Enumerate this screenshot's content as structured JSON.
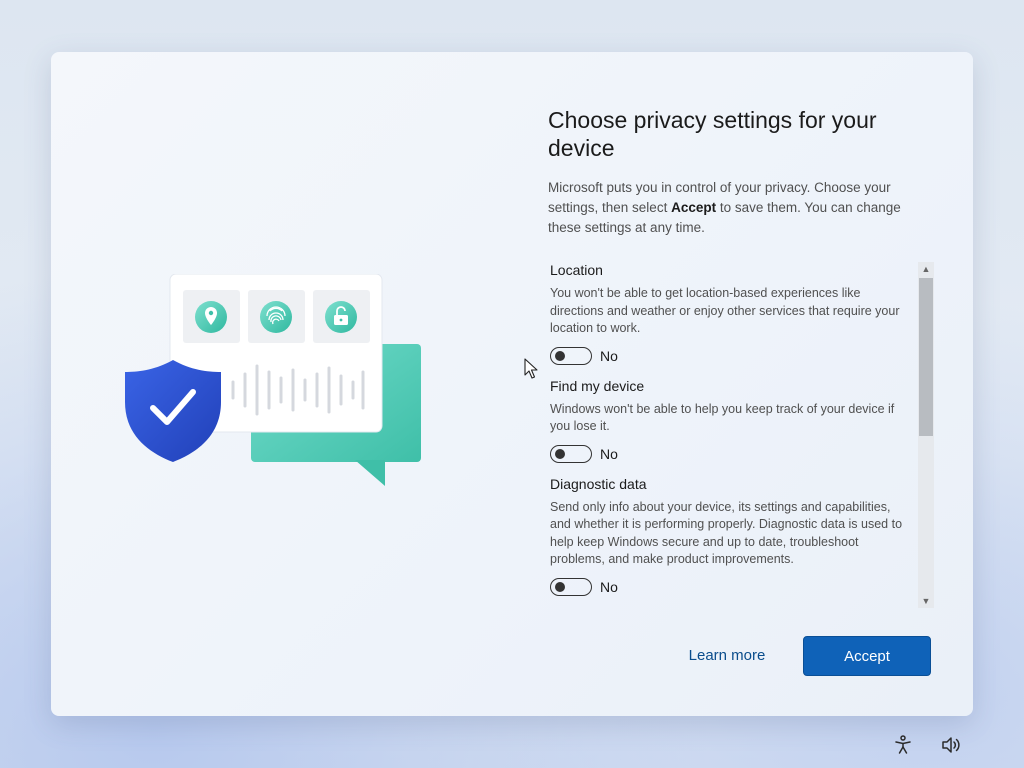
{
  "dialog": {
    "title": "Choose privacy settings for your device",
    "intro_before": "Microsoft puts you in control of your privacy. Choose your settings, then select ",
    "intro_bold": "Accept",
    "intro_after": " to save them. You can change these settings at any time."
  },
  "settings": [
    {
      "title": "Location",
      "description": "You won't be able to get location-based experiences like directions and weather or enjoy other services that require your location to work.",
      "toggle_label": "No"
    },
    {
      "title": "Find my device",
      "description": "Windows won't be able to help you keep track of your device if you lose it.",
      "toggle_label": "No"
    },
    {
      "title": "Diagnostic data",
      "description": "Send only info about your device, its settings and capabilities, and whether it is performing properly. Diagnostic data is used to help keep Windows secure and up to date, troubleshoot problems, and make product improvements.",
      "toggle_label": "No"
    }
  ],
  "buttons": {
    "learn_more": "Learn more",
    "accept": "Accept"
  },
  "colors": {
    "accent": "#0f62b8",
    "link": "#0a4d8c",
    "shield": "#2b55d8",
    "chat_bubble": "#5fd3c0"
  },
  "icons": {
    "illustration": [
      "shield-check-icon",
      "location-pin-icon",
      "fingerprint-icon",
      "unlock-icon",
      "chat-bubble-icon"
    ],
    "tray": [
      "accessibility-icon",
      "volume-icon"
    ]
  }
}
